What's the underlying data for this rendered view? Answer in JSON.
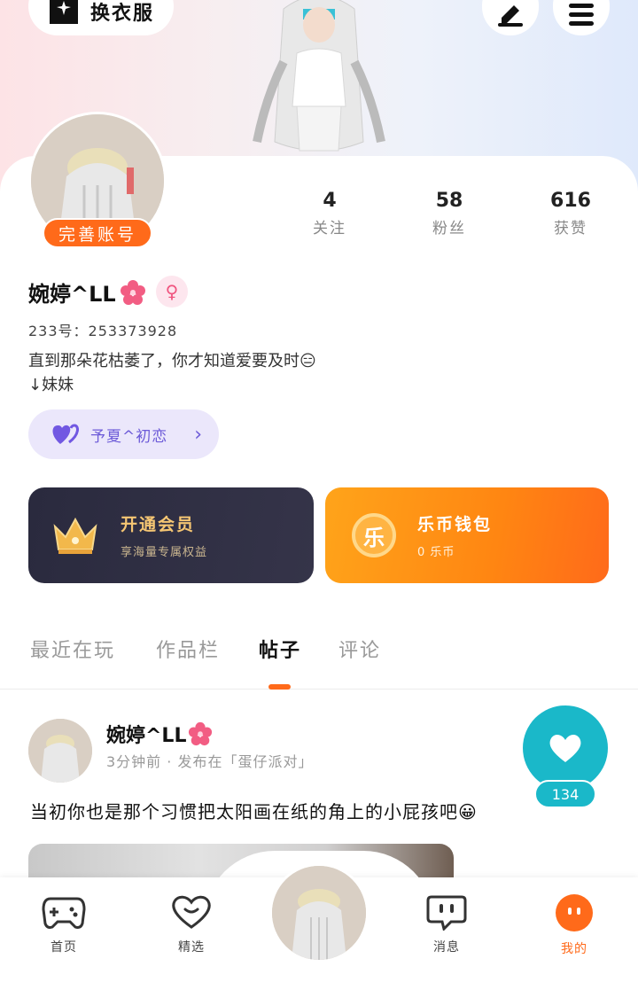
{
  "header": {
    "outfit_label": "换衣服",
    "edit_icon": "edit-icon",
    "menu_icon": "menu-icon"
  },
  "profile": {
    "perfect_badge": "完善账号",
    "username": "婉婷^LL",
    "uid_label": "233号：253373928",
    "bio_line1": "直到那朵花枯萎了，你才知道爱要及时😑",
    "bio_line2": "↓妹妹",
    "gender": "female"
  },
  "stats": [
    {
      "num": "4",
      "label": "关注"
    },
    {
      "num": "58",
      "label": "粉丝"
    },
    {
      "num": "616",
      "label": "获赞"
    }
  ],
  "couple": {
    "label": "予夏^初恋"
  },
  "cards": {
    "vip_title": "开通会员",
    "vip_subtitle": "享海量专属权益",
    "coin_title": "乐币钱包",
    "coin_subtitle": "0 乐币",
    "coin_glyph": "乐"
  },
  "tabs": [
    {
      "label": "最近在玩",
      "active": false
    },
    {
      "label": "作品栏",
      "active": false
    },
    {
      "label": "帖子",
      "active": true
    },
    {
      "label": "评论",
      "active": false
    }
  ],
  "post": {
    "author": "婉婷^LL",
    "meta": "3分钟前 · 发布在「蛋仔派对」",
    "text": "当初你也是那个习惯把太阳画在纸的角上的小屁孩吧😀",
    "likes": "134"
  },
  "nav": [
    {
      "label": "首页",
      "icon": "gamepad-icon",
      "active": false
    },
    {
      "label": "精选",
      "icon": "heart-smile-icon",
      "active": false
    },
    {
      "label": "消息",
      "icon": "chat-icon",
      "active": false
    },
    {
      "label": "我的",
      "icon": "face-icon",
      "active": true
    }
  ],
  "colors": {
    "accent": "#ff6a1a",
    "like": "#1ab8c9",
    "couple": "#6d5bd8"
  }
}
